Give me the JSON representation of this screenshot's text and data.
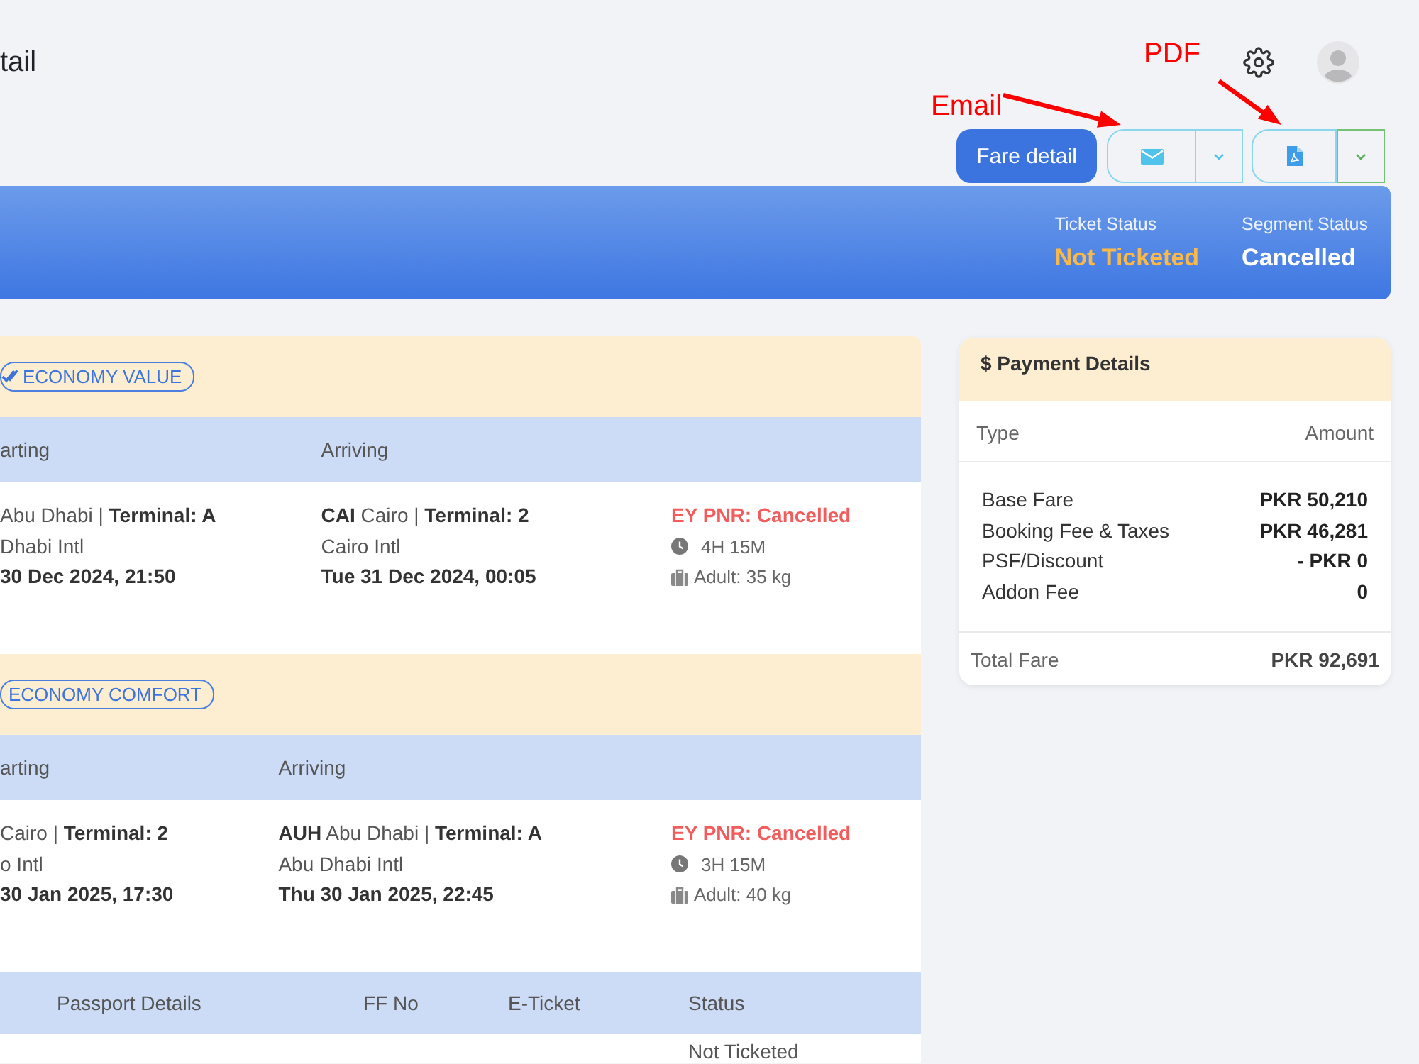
{
  "page": {
    "title": "tail"
  },
  "annotations": [
    {
      "text": "Email"
    },
    {
      "text": "PDF"
    }
  ],
  "toolbar": {
    "fare_detail": "Fare detail"
  },
  "banner": {
    "statuses": [
      {
        "label": "Ticket Status",
        "value": "Not Ticketed",
        "color": "#f9b84a"
      },
      {
        "label": "Segment Status",
        "value": "Cancelled",
        "color": "#ffffff"
      }
    ]
  },
  "segments": [
    {
      "cabin": "ECONOMY VALUE",
      "columns": [
        "arting",
        "Arriving"
      ],
      "departing": {
        "place": "Abu Dhabi | **Terminal: A**",
        "airport": "Dhabi Intl",
        "time": "30 Dec 2024, 21:50"
      },
      "arriving": {
        "place": "**CAI** Cairo | **Terminal: 2**",
        "airport": "Cairo Intl",
        "time": "Tue 31 Dec 2024, 00:05"
      },
      "pnr": "EY PNR: Cancelled",
      "duration": "4H 15M",
      "baggage": "Adult: 35 kg"
    },
    {
      "cabin": "ECONOMY COMFORT",
      "columns": [
        "arting",
        "Arriving"
      ],
      "departing": {
        "place": "Cairo | **Terminal: 2**",
        "airport": "o Intl",
        "time": "30 Jan 2025, 17:30"
      },
      "arriving": {
        "place": "**AUH** Abu Dhabi | **Terminal: A**",
        "airport": "Abu Dhabi Intl",
        "time": "Thu 30 Jan 2025, 22:45"
      },
      "pnr": "EY PNR: Cancelled",
      "duration": "3H 15M",
      "baggage": "Adult: 40 kg"
    }
  ],
  "passengers": {
    "columns": [
      "Passport Details",
      "FF No",
      "E-Ticket",
      "Status"
    ],
    "rows": [
      {
        "status": "Not Ticketed"
      }
    ]
  },
  "payment": {
    "title": "$ Payment Details",
    "columns": [
      "Type",
      "Amount"
    ],
    "rows": [
      {
        "type": "Base Fare",
        "amount": "PKR 50,210"
      },
      {
        "type": "Booking Fee & Taxes",
        "amount": "PKR 46,281"
      },
      {
        "type": "PSF/Discount",
        "amount": "- PKR 0"
      },
      {
        "type": "Addon Fee",
        "amount": "0"
      }
    ],
    "total": {
      "label": "Total Fare",
      "amount": "PKR 92,691"
    }
  }
}
